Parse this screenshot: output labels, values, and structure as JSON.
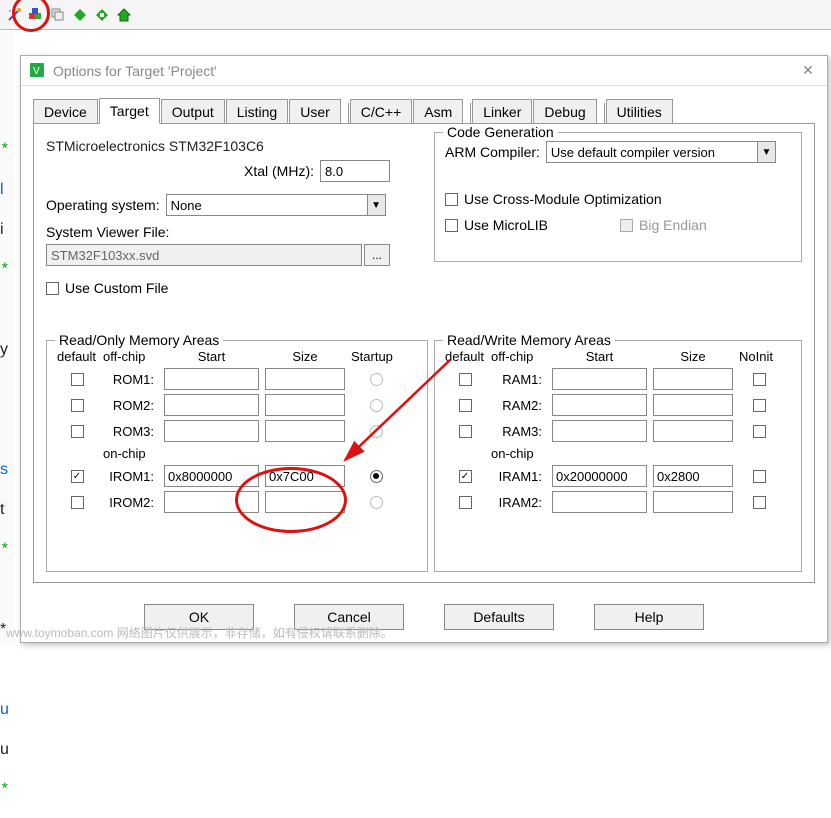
{
  "toolbar": {
    "icons": [
      "magic-wand-icon",
      "color-cubes-icon",
      "stack-icon",
      "green-diamond-icon",
      "green-diamond2-icon",
      "home-icon"
    ]
  },
  "dialog": {
    "title": "Options for Target 'Project'",
    "tabs": [
      "Device",
      "Target",
      "Output",
      "Listing",
      "User",
      "C/C++",
      "Asm",
      "Linker",
      "Debug",
      "Utilities"
    ],
    "active_tab": "Target",
    "device": "STMicroelectronics STM32F103C6",
    "xtal_label": "Xtal (MHz):",
    "xtal_value": "8.0",
    "os_label": "Operating system:",
    "os_value": "None",
    "svd_label": "System Viewer File:",
    "svd_value": "STM32F103xx.svd",
    "custom_file_label": "Use Custom File",
    "codegen": {
      "legend": "Code Generation",
      "compiler_label": "ARM Compiler:",
      "compiler_value": "Use default compiler version",
      "cross_module_label": "Use Cross-Module Optimization",
      "microlib_label": "Use MicroLIB",
      "big_endian_label": "Big Endian"
    },
    "mem_ro": {
      "legend": "Read/Only Memory Areas",
      "hdr_default": "default",
      "hdr_offchip": "off-chip",
      "hdr_start": "Start",
      "hdr_size": "Size",
      "hdr_startup": "Startup",
      "hdr_onchip": "on-chip",
      "rows": [
        {
          "label": "ROM1:",
          "start": "",
          "size": "",
          "checked": false,
          "selected": false
        },
        {
          "label": "ROM2:",
          "start": "",
          "size": "",
          "checked": false,
          "selected": false
        },
        {
          "label": "ROM3:",
          "start": "",
          "size": "",
          "checked": false,
          "selected": false
        },
        {
          "label": "IROM1:",
          "start": "0x8000000",
          "size": "0x7C00",
          "checked": true,
          "selected": true
        },
        {
          "label": "IROM2:",
          "start": "",
          "size": "",
          "checked": false,
          "selected": false
        }
      ]
    },
    "mem_rw": {
      "legend": "Read/Write Memory Areas",
      "hdr_default": "default",
      "hdr_offchip": "off-chip",
      "hdr_start": "Start",
      "hdr_size": "Size",
      "hdr_noinit": "NoInit",
      "hdr_onchip": "on-chip",
      "rows": [
        {
          "label": "RAM1:",
          "start": "",
          "size": "",
          "checked": false,
          "noinit": false
        },
        {
          "label": "RAM2:",
          "start": "",
          "size": "",
          "checked": false,
          "noinit": false
        },
        {
          "label": "RAM3:",
          "start": "",
          "size": "",
          "checked": false,
          "noinit": false
        },
        {
          "label": "IRAM1:",
          "start": "0x20000000",
          "size": "0x2800",
          "checked": true,
          "noinit": false
        },
        {
          "label": "IRAM2:",
          "start": "",
          "size": "",
          "checked": false,
          "noinit": false
        }
      ]
    },
    "buttons": {
      "ok": "OK",
      "cancel": "Cancel",
      "defaults": "Defaults",
      "help": "Help"
    }
  },
  "watermark": "www.toymoban.com 网络图片仅供展示，非存储，如有侵权请联系删除。"
}
